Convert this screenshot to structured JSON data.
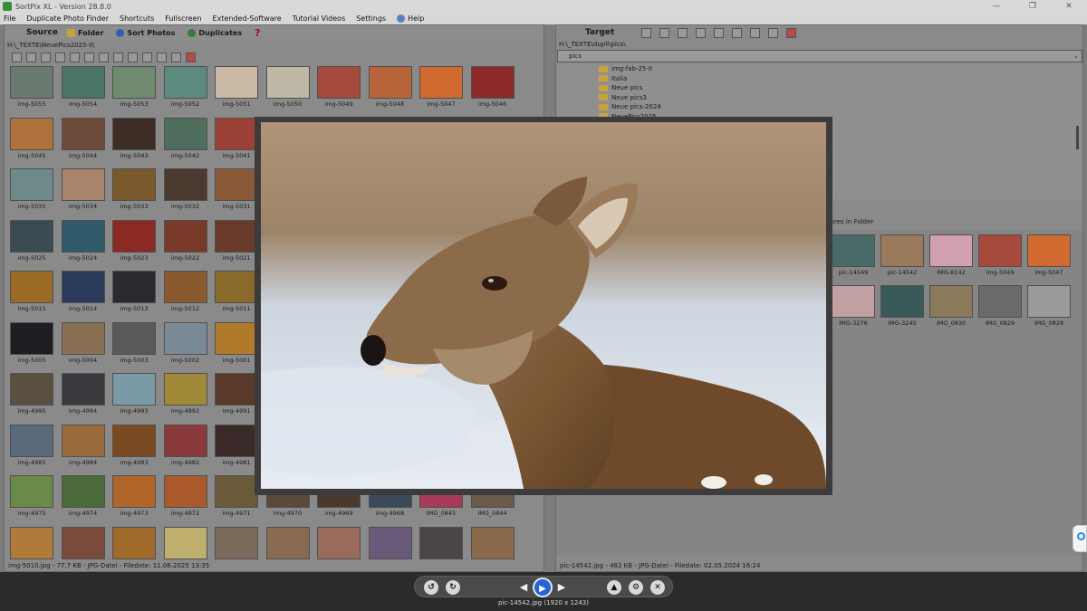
{
  "window": {
    "title": "SortPix XL - Version 28.8.0",
    "controls": [
      "—",
      "❐",
      "✕"
    ]
  },
  "menu": [
    "File",
    "Duplicate Photo Finder",
    "Shortcuts",
    "Fullscreen",
    "Extended-Software",
    "Tutorial Videos",
    "Settings",
    "Help"
  ],
  "source": {
    "label": "Source",
    "buttons": {
      "folder": "Folder",
      "sort": "Sort Photos",
      "duplicates": "Duplicates"
    },
    "path": "H:\\_TEXTE\\NeuePics2025-II\\",
    "status": "img-5010.jpg - 77,7 KB - JPG-Datei - Filedate: 11.06.2025 13:35",
    "thumbs": [
      {
        "label": "img-5055",
        "color": "#6a7a70"
      },
      {
        "label": "img-5054",
        "color": "#4a7468"
      },
      {
        "label": "img-5053",
        "color": "#6f8a6e"
      },
      {
        "label": "img-5052",
        "color": "#5d8a7f"
      },
      {
        "label": "img-5051",
        "color": "#c9b8a3"
      },
      {
        "label": "img-5050",
        "color": "#bfb8a6"
      },
      {
        "label": "img-5049",
        "color": "#a64a3c"
      },
      {
        "label": "img-5048",
        "color": "#b8643a"
      },
      {
        "label": "img-5047",
        "color": "#d06a2e"
      },
      {
        "label": "img-5046",
        "color": "#8c2a2a"
      },
      {
        "label": "img-5045",
        "color": "#b0723c"
      },
      {
        "label": "img-5044",
        "color": "#6e4a3a"
      },
      {
        "label": "img-5043",
        "color": "#3e2c26"
      },
      {
        "label": "img-5042",
        "color": "#4f6e5e"
      },
      {
        "label": "img-5041",
        "color": "#9a4034"
      },
      {
        "label": "img-5035",
        "color": "#6e8a8a"
      },
      {
        "label": "img-5034",
        "color": "#a8846a"
      },
      {
        "label": "img-5033",
        "color": "#7a5a2c"
      },
      {
        "label": "img-5032",
        "color": "#4a3a30"
      },
      {
        "label": "img-5031",
        "color": "#8a5a38"
      },
      {
        "label": "img-5025",
        "color": "#3a4a52"
      },
      {
        "label": "img-5024",
        "color": "#2e5a6a"
      },
      {
        "label": "img-5023",
        "color": "#8a2a22"
      },
      {
        "label": "img-5022",
        "color": "#7a3a2a"
      },
      {
        "label": "img-5021",
        "color": "#6a3a2a"
      },
      {
        "label": "img-5015",
        "color": "#9a6a26"
      },
      {
        "label": "img-5014",
        "color": "#2a3a5a"
      },
      {
        "label": "img-5013",
        "color": "#2a2a30"
      },
      {
        "label": "img-5012",
        "color": "#8a5a2e"
      },
      {
        "label": "img-5011",
        "color": "#8a6a2a"
      },
      {
        "label": "img-5005",
        "color": "#1e1e22"
      },
      {
        "label": "img-5004",
        "color": "#8a7052"
      },
      {
        "label": "img-5003",
        "color": "#5a5a5a"
      },
      {
        "label": "img-5002",
        "color": "#7a8a96"
      },
      {
        "label": "img-5001",
        "color": "#b07a2a"
      },
      {
        "label": "img-4995",
        "color": "#5a5040"
      },
      {
        "label": "img-4994",
        "color": "#3a3a3e"
      },
      {
        "label": "img-4993",
        "color": "#7a9aa6"
      },
      {
        "label": "img-4992",
        "color": "#a08a3a"
      },
      {
        "label": "img-4991",
        "color": "#5a3a2a"
      },
      {
        "label": "img-4985",
        "color": "#5a6a7a"
      },
      {
        "label": "img-4984",
        "color": "#9a6a3a"
      },
      {
        "label": "img-4983",
        "color": "#7a4a22"
      },
      {
        "label": "img-4982",
        "color": "#8a3a3a"
      },
      {
        "label": "img-4981",
        "color": "#3a2a2a"
      },
      {
        "label": "img-4975",
        "color": "#6a8a4a"
      },
      {
        "label": "img-4974",
        "color": "#4a6a3a"
      },
      {
        "label": "img-4973",
        "color": "#b0662a"
      },
      {
        "label": "img-4972",
        "color": "#aa5a2a"
      },
      {
        "label": "img-4971",
        "color": "#6a5a3a"
      },
      {
        "label": "img-4970",
        "color": "#5a4a3a"
      },
      {
        "label": "img-4969",
        "color": "#4a3a2e"
      },
      {
        "label": "img-4968",
        "color": "#3a4a5a"
      },
      {
        "label": "IMG_0845",
        "color": "#aa3a5a"
      },
      {
        "label": "IMG_0844",
        "color": "#6a5a4a"
      },
      {
        "label": "",
        "color": "#b07a3a"
      },
      {
        "label": "",
        "color": "#7a4a3a"
      },
      {
        "label": "",
        "color": "#a06a2a"
      },
      {
        "label": "",
        "color": "#c0b070"
      },
      {
        "label": "",
        "color": "#7a6a5a"
      },
      {
        "label": "",
        "color": "#8a6a50"
      },
      {
        "label": "",
        "color": "#9a6a5a"
      },
      {
        "label": "",
        "color": "#6a5a7a"
      },
      {
        "label": "",
        "color": "#4a4444"
      },
      {
        "label": "",
        "color": "#8a6a4a"
      }
    ]
  },
  "target": {
    "label": "Target",
    "path": "H:\\_TEXTE\\dupli\\pics\\",
    "selected_folder": "pics",
    "folders": [
      "img-fab-25-II",
      "Italia",
      "Neue pics",
      "Neue pics3",
      "Neue pics-2024",
      "NeuePics2025"
    ],
    "section_label": "ctures in Folder",
    "status": "pic-14542.jpg - 482 KB - JPG-Datei - Filedate: 02.05.2024 16:24",
    "thumbs": [
      {
        "label": "pic-14549",
        "color": "#4a6a6a"
      },
      {
        "label": "pic-14542",
        "color": "#9a7a5a"
      },
      {
        "label": "IMG-8142",
        "color": "#d0a0b0"
      },
      {
        "label": "img-5049",
        "color": "#a64a3c"
      },
      {
        "label": "img-5047",
        "color": "#d06a2e"
      },
      {
        "label": "IMG-3276",
        "color": "#c0a0a0"
      },
      {
        "label": "IMG-3245",
        "color": "#3a5a5a"
      },
      {
        "label": "IMG_0830",
        "color": "#8a7a5a"
      },
      {
        "label": "IMG_0829",
        "color": "#6a6a6a"
      },
      {
        "label": "IMG_0828",
        "color": "#9a9a9a"
      }
    ]
  },
  "viewer": {
    "caption": "pic-14542.jpg (1920 x 1243)",
    "buttons": {
      "rotate_left": "↺",
      "rotate_right": "↻",
      "prev": "◀",
      "play": "▶",
      "next": "▶",
      "up": "▲",
      "settings": "⚙",
      "close": "✕"
    }
  },
  "colors": {
    "accent": "#2563d9",
    "dialog_bg": "#2b2b2b"
  }
}
